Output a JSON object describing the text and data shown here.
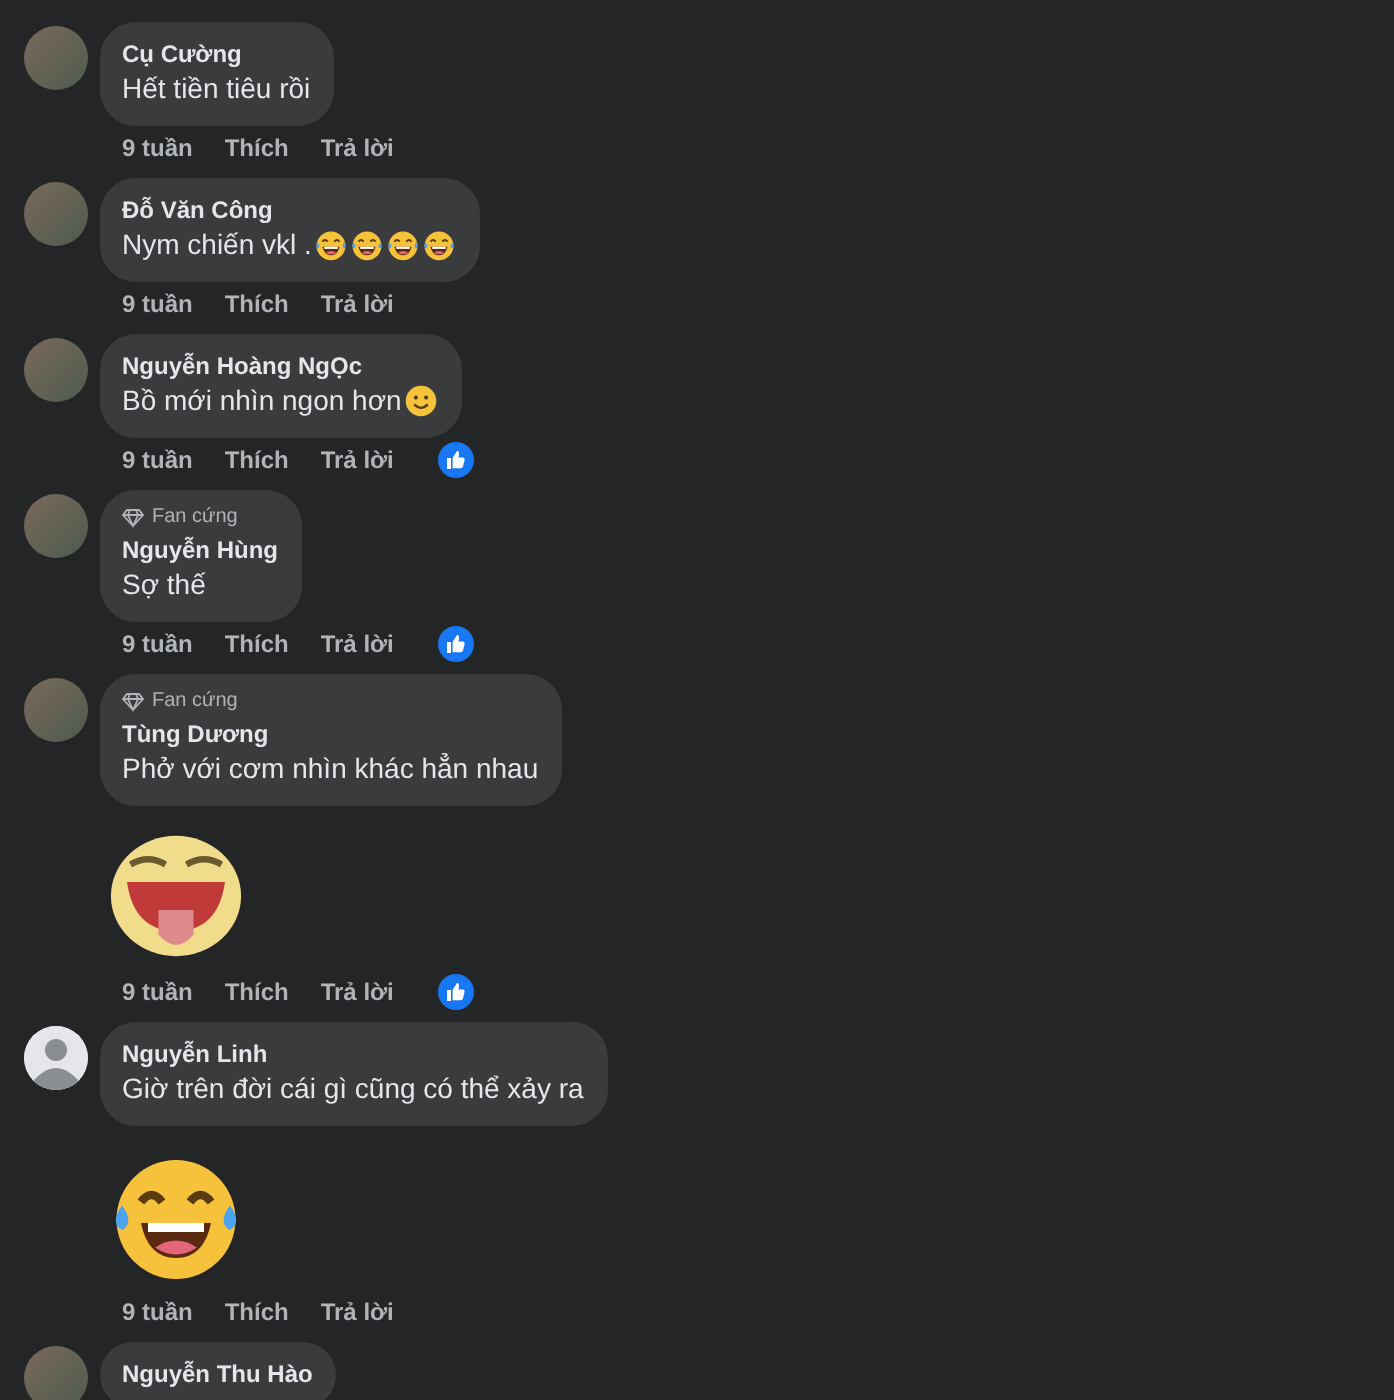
{
  "comments": [
    {
      "default_avatar": false,
      "name": "Cụ Cường",
      "text": "Hết tiền tiêu rồi",
      "time": "9 tuần",
      "like_action": "Thích",
      "reply_action": "Trả lời",
      "liked": false
    },
    {
      "default_avatar": false,
      "name": "Đỗ Văn Công",
      "text": "Nym chiến vkl .",
      "inline_emojis": [
        {
          "kind": "laugh"
        },
        {
          "kind": "laugh"
        },
        {
          "kind": "laugh"
        },
        {
          "kind": "laugh"
        }
      ],
      "time": "9 tuần",
      "like_action": "Thích",
      "reply_action": "Trả lời",
      "liked": false
    },
    {
      "default_avatar": false,
      "name": "Nguyễn Hoàng NgỌc",
      "text": "Bồ mới nhìn ngon hơn",
      "inline_emojis": [
        {
          "kind": "smile"
        }
      ],
      "time": "9 tuần",
      "like_action": "Thích",
      "reply_action": "Trả lời",
      "liked": true
    },
    {
      "default_avatar": false,
      "badge": "Fan cứng",
      "name": "Nguyễn Hùng",
      "text": "Sợ thế",
      "time": "9 tuần",
      "like_action": "Thích",
      "reply_action": "Trả lời",
      "liked": true
    },
    {
      "default_avatar": false,
      "badge": "Fan cứng",
      "name": "Tùng Dương",
      "text": "Phở với cơm nhìn khác hẳn nhau",
      "sticker": {
        "kind": "tongue"
      },
      "time": "9 tuần",
      "like_action": "Thích",
      "reply_action": "Trả lời",
      "liked": true
    },
    {
      "default_avatar": true,
      "name": "Nguyễn Linh",
      "text": "Giờ trên đời cái gì cũng có thể xảy ra",
      "sticker": {
        "kind": "laugh"
      },
      "time": "9 tuần",
      "like_action": "Thích",
      "reply_action": "Trả lời",
      "liked": false
    },
    {
      "default_avatar": false,
      "name": "Nguyễn Thu Hào"
    }
  ]
}
